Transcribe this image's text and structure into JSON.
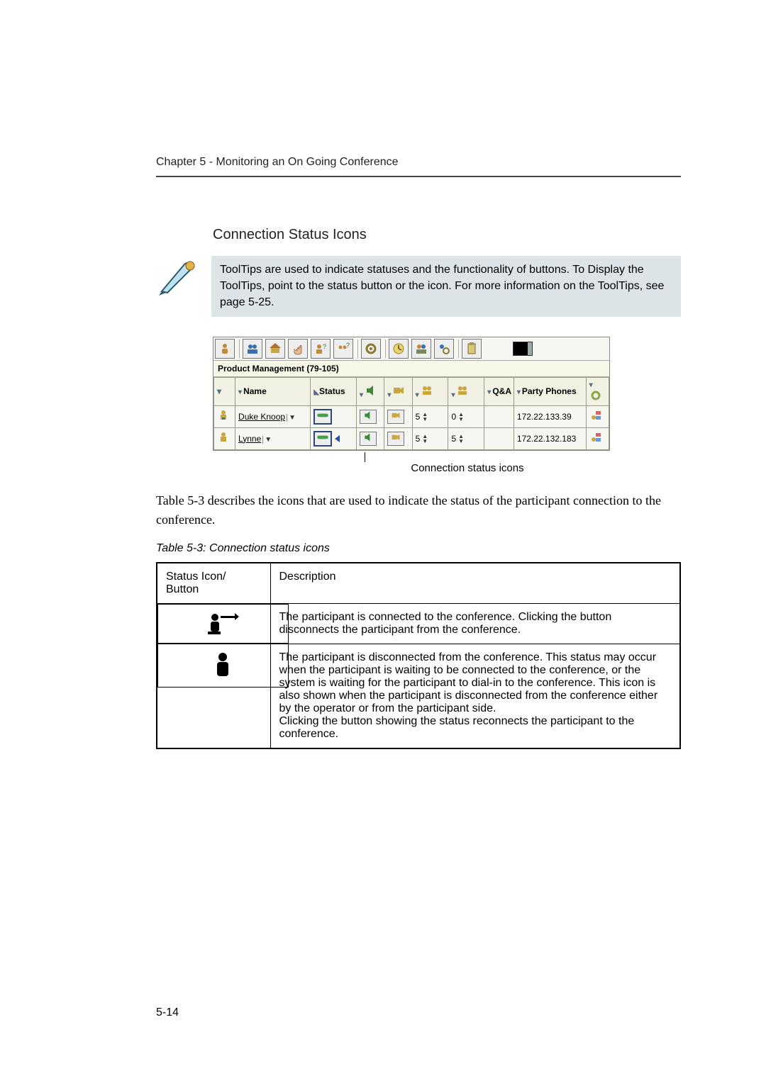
{
  "chapter_line": "Chapter 5 - Monitoring an On Going Conference",
  "section_title": "Connection Status Icons",
  "note_text": "ToolTips are used to indicate statuses and the functionality of buttons. To Display the ToolTips, point to the status button or the icon. For more information on the ToolTips, see page 5-25.",
  "panel": {
    "conference_title": "Product Management (79-105)",
    "columns": {
      "name": "Name",
      "status": "Status",
      "qa": "Q&A",
      "party_phones": "Party Phones"
    },
    "rows": [
      {
        "name": "Duke Knoop",
        "qa": "5",
        "second": "0",
        "phone": "172.22.133.39"
      },
      {
        "name": "Lynne",
        "qa": "5",
        "second": "5",
        "phone": "172.22.132.183"
      }
    ],
    "caption": "Connection status icons"
  },
  "body_paragraph": "Table 5-3 describes the icons that are used to indicate the status of the participant connection to the conference.",
  "table": {
    "caption": "Table 5-3: Connection status icons",
    "head": {
      "c1": "Status Icon/ Button",
      "c2": "Description"
    },
    "rows": [
      {
        "desc": "The participant is connected to the conference. Clicking the button disconnects the participant from the conference."
      },
      {
        "desc": "The participant is disconnected from the conference. This status may occur when the participant is waiting to be connected to the conference, or the system is waiting for the participant to dial-in to the conference. This icon is also shown when the participant is disconnected from the conference either by the operator or from the participant side.\nClicking the button showing the status reconnects the participant to the conference."
      }
    ]
  },
  "page_number": "5-14"
}
